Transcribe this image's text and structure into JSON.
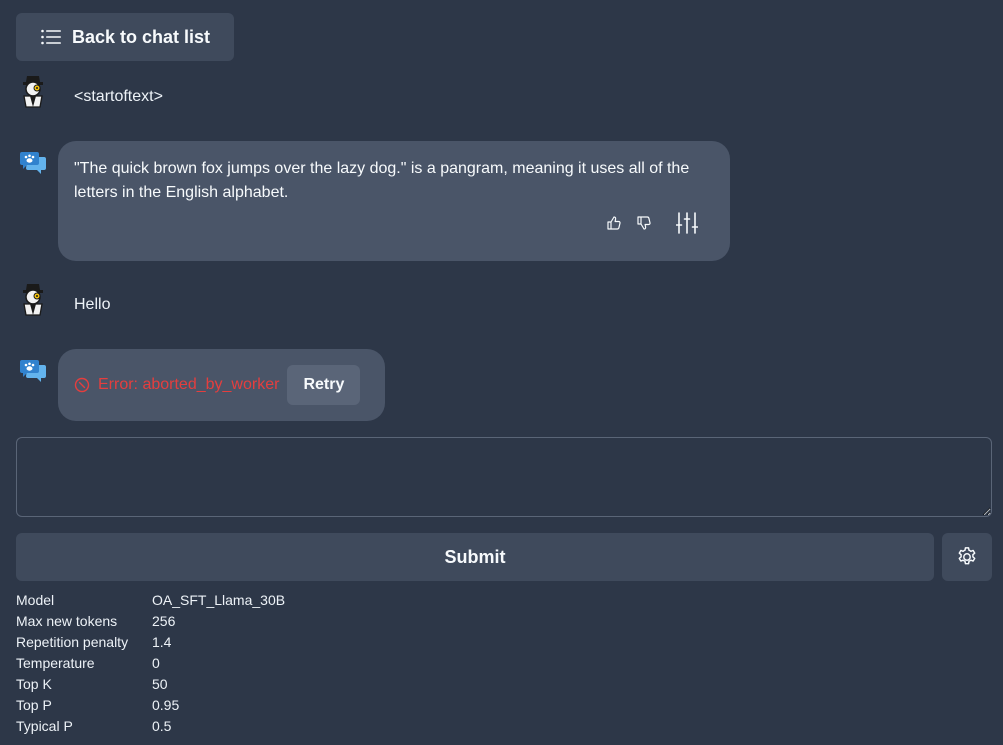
{
  "header": {
    "back_label": "Back to chat list",
    "back_icon": "list-icon"
  },
  "messages": [
    {
      "role": "user",
      "avatar": "user-avatar",
      "text": "<startoftext>"
    },
    {
      "role": "assistant",
      "icon": "assistant-chat-icon",
      "text": "\"The quick brown fox jumps over the lazy dog.\" is a pangram, meaning it uses all of the letters in the English alphabet.",
      "actions": [
        "thumbs-up-icon",
        "thumbs-down-icon",
        "sliders-icon"
      ]
    },
    {
      "role": "user",
      "avatar": "user-avatar",
      "text": "Hello"
    },
    {
      "role": "assistant",
      "icon": "assistant-chat-icon",
      "error_icon": "error-circle-icon",
      "error_text": "Error: aborted_by_worker",
      "retry_label": "Retry"
    }
  ],
  "input": {
    "value": "",
    "placeholder": ""
  },
  "submit_label": "Submit",
  "settings_icon": "gear-icon",
  "params": [
    {
      "label": "Model",
      "value": "OA_SFT_Llama_30B"
    },
    {
      "label": "Max new tokens",
      "value": "256"
    },
    {
      "label": "Repetition penalty",
      "value": "1.4"
    },
    {
      "label": "Temperature",
      "value": "0"
    },
    {
      "label": "Top K",
      "value": "50"
    },
    {
      "label": "Top P",
      "value": "0.95"
    },
    {
      "label": "Typical P",
      "value": "0.5"
    }
  ],
  "colors": {
    "background": "#2d3748",
    "bubble": "#4a5568",
    "button": "#3f4a5c",
    "error": "#e53e3e",
    "assistant_icon": "#3182ce"
  }
}
